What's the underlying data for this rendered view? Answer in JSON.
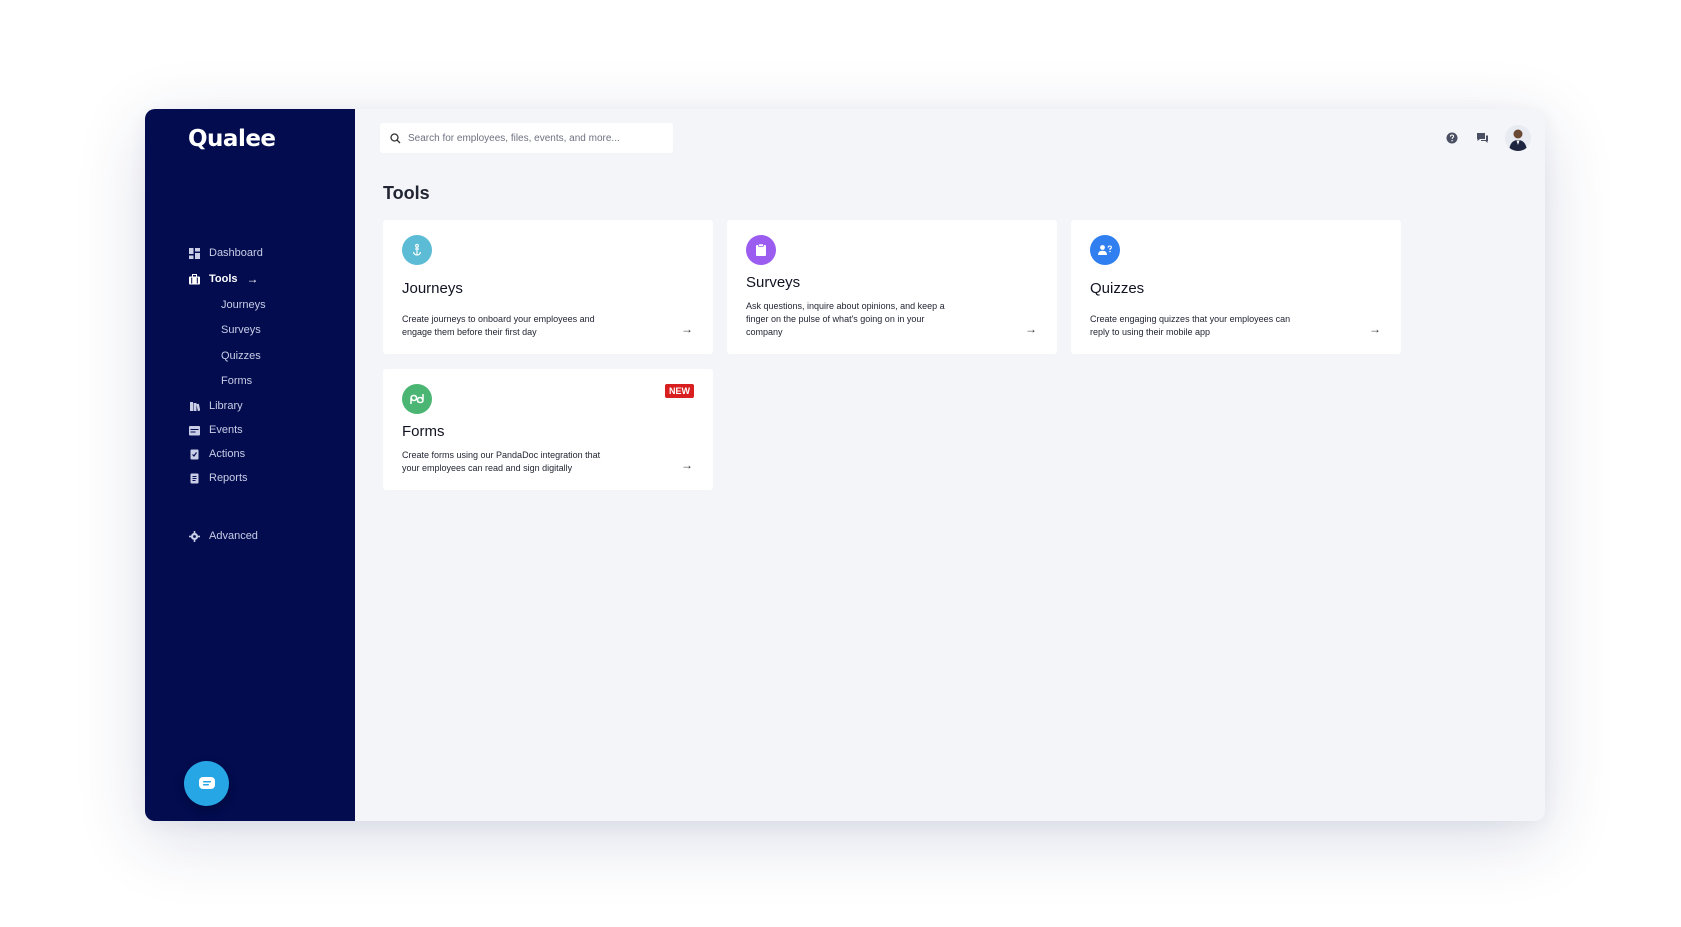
{
  "app": {
    "name": "Qualee"
  },
  "sidebar": {
    "items": [
      {
        "label": "Dashboard",
        "icon": "dashboard-icon"
      },
      {
        "label": "Tools",
        "icon": "briefcase-icon",
        "active": true
      },
      {
        "label": "Library",
        "icon": "library-icon"
      },
      {
        "label": "Events",
        "icon": "calendar-icon"
      },
      {
        "label": "Actions",
        "icon": "actions-icon"
      },
      {
        "label": "Reports",
        "icon": "reports-icon"
      }
    ],
    "tools_submenu": [
      "Journeys",
      "Surveys",
      "Quizzes",
      "Forms"
    ],
    "advanced_label": "Advanced",
    "active_arrow": "→"
  },
  "search": {
    "placeholder": "Search for employees, files, events, and more..."
  },
  "page": {
    "title": "Tools"
  },
  "cards": [
    {
      "title": "Journeys",
      "description": "Create journeys to onboard your employees and engage them before their first day",
      "icon": "anchor-icon",
      "icon_color": "#5cbcd6"
    },
    {
      "title": "Surveys",
      "description": "Ask questions, inquire about opinions, and keep a finger on the pulse of what's going on in your company",
      "icon": "clipboard-icon",
      "icon_color": "#9b5cf0"
    },
    {
      "title": "Quizzes",
      "description": "Create engaging quizzes that your employees can reply to using their mobile app",
      "icon": "user-question-icon",
      "icon_color": "#2f7ff0"
    },
    {
      "title": "Forms",
      "description": "Create forms using our PandaDoc integration that your employees can read and sign digitally",
      "icon": "pandadoc-icon",
      "icon_color": "#4bb673",
      "badge": "NEW"
    }
  ],
  "card_arrow": "→",
  "colors": {
    "sidebar_bg": "#020c4f",
    "page_bg": "#f4f5f8",
    "badge": "#d81e1e",
    "chat_button": "#27a6e6"
  }
}
